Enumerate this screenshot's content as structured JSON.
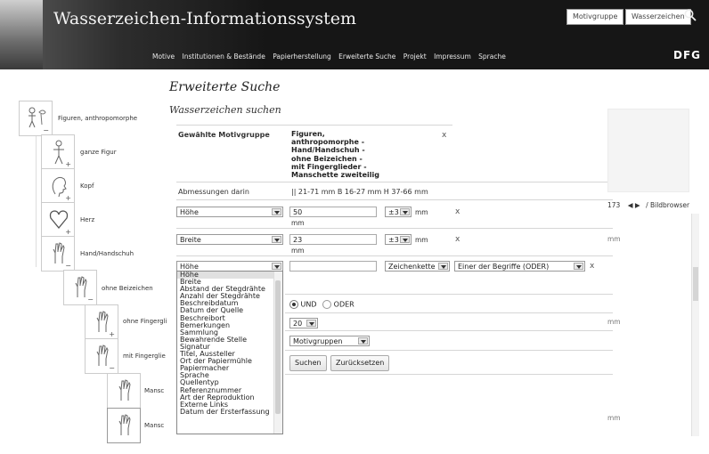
{
  "header": {
    "site_title": "Wasserzeichen-Informationssystem",
    "btn_motivgruppe": "Motivgruppe",
    "btn_wasserzeichen": "Wasserzeichen",
    "nav": [
      "Motive",
      "Institutionen & Bestände",
      "Papierherstellung",
      "Erweiterte Suche",
      "Projekt",
      "Impressum",
      "Sprache"
    ],
    "logo": "DFG"
  },
  "page": {
    "title": "Erweiterte Suche",
    "subtitle": "Wasserzeichen suchen"
  },
  "tree": [
    {
      "label": "Figuren, anthropomorphe",
      "toggle": "−"
    },
    {
      "label": "ganze Figur",
      "toggle": "+"
    },
    {
      "label": "Kopf",
      "toggle": "+"
    },
    {
      "label": "Herz",
      "toggle": "+"
    },
    {
      "label": "Hand/Handschuh",
      "toggle": "−"
    },
    {
      "label": "ohne Beizeichen",
      "toggle": "−"
    },
    {
      "label": "ohne Fingergli",
      "toggle": "+"
    },
    {
      "label": "mit Fingerglie",
      "toggle": "−"
    },
    {
      "label": "Mansc",
      "toggle": ""
    },
    {
      "label": "Mansc",
      "toggle": ""
    }
  ],
  "form": {
    "motivgruppe_label": "Gewählte Motivgruppe",
    "motivgruppe_value": "Figuren, anthropomorphe - Hand/Handschuh - ohne Beizeichen - mit Fingerglieder - Manschette zweiteilig",
    "motivgruppe_lines": [
      "Figuren,",
      "anthropomorphe -",
      "Hand/Handschuh -",
      "ohne Beizeichen -",
      "mit Fingerglieder -",
      "Manschette zweiteilig"
    ],
    "close": "x",
    "abm_label": "Abmessungen darin",
    "abm_value": "|| 21-71 mm  B 16-27 mm  H 37-66 mm",
    "row1": {
      "field": "Höhe",
      "value": "50",
      "unit": "mm",
      "tol": "±3",
      "tol_unit": "mm",
      "close": "x"
    },
    "row2": {
      "field": "Breite",
      "value": "23",
      "unit": "mm",
      "tol": "±3",
      "tol_unit": "mm",
      "close": "x"
    },
    "row3": {
      "field": "Höhe",
      "value": "",
      "mode": "Zeichenkette",
      "match": "Einer der Begriffe (ODER)",
      "close": "x"
    },
    "logic_und": "UND",
    "logic_oder": "ODER",
    "per_page": "20",
    "result_type": "Motivgruppen",
    "search_btn": "Suchen",
    "reset_btn": "Zurücksetzen"
  },
  "dropdown_options": [
    "Höhe",
    "Breite",
    "Abstand der Stegdrähte",
    "Anzahl der Stegdrähte",
    "Beschreibdatum",
    "Datum der Quelle",
    "Beschreibort",
    "Bemerkungen",
    "Sammlung",
    "Bewahrende Stelle",
    "Signatur",
    "Titel, Aussteller",
    "Ort der Papiermühle",
    "Papiermacher",
    "Sprache",
    "Quellentyp",
    "Referenznummer",
    "Art der Reproduktion",
    "Externe Links",
    "Datum der Ersterfassung"
  ],
  "right_panel": {
    "counter": "173",
    "bildbrowser": "/ Bildbrowser",
    "mm1": "mm",
    "mm2": "mm",
    "mm3": "mm"
  }
}
